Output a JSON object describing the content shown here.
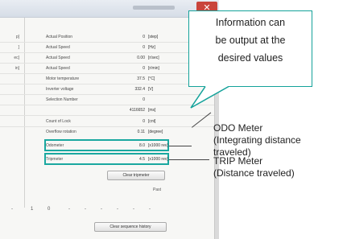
{
  "window": {
    "close_glyph": "✕"
  },
  "left_column": [
    {
      "text": "p]"
    },
    {
      "text": "]"
    },
    {
      "text": "ec]"
    },
    {
      "text": "in]"
    }
  ],
  "params": [
    {
      "label": "Actual Position",
      "value": "0",
      "unit": "[step]"
    },
    {
      "label": "Actual Speed",
      "value": "0",
      "unit": "[Hz]"
    },
    {
      "label": "Actual Speed",
      "value": "0.00",
      "unit": "[r/sec]"
    },
    {
      "label": "Actual Speed",
      "value": "0",
      "unit": "[r/min]"
    },
    {
      "label": "Motor temperature",
      "value": "37.5",
      "unit": "[°C]"
    },
    {
      "label": "Inverter voltage",
      "value": "332.4",
      "unit": "[V]"
    },
    {
      "label": "Selection Number",
      "value": "0",
      "unit": ""
    },
    {
      "label": "",
      "value": "4116652",
      "unit": "[ms]"
    },
    {
      "label": "Count of Lock",
      "value": "0",
      "unit": "[cnt]"
    },
    {
      "label": "Overflow rotation",
      "value": "0.11",
      "unit": "[degree]"
    },
    {
      "label": "Odometer",
      "value": "8.0",
      "unit": "[x1000 rev]"
    },
    {
      "label": "Tripmeter",
      "value": "4.5",
      "unit": "[x1000 rev]"
    }
  ],
  "buttons": {
    "clear_tripmeter": "Clear tripmeter",
    "clear_sequence_history": "Clear sequence history"
  },
  "past_label": "Past",
  "sequence_row": [
    "-",
    "1",
    "0",
    "-",
    "-",
    "-",
    "-",
    "-",
    "-"
  ],
  "callout": {
    "lines": [
      "Information can",
      "be output at the",
      "desired values"
    ]
  },
  "annotations": {
    "odo": [
      "ODO Meter",
      "(Integrating distance",
      "traveled)"
    ],
    "trip": [
      "TRIP Meter",
      "(Distance traveled)"
    ]
  },
  "colors": {
    "accent": "#1aa8a0",
    "close_button": "#c9443b"
  }
}
